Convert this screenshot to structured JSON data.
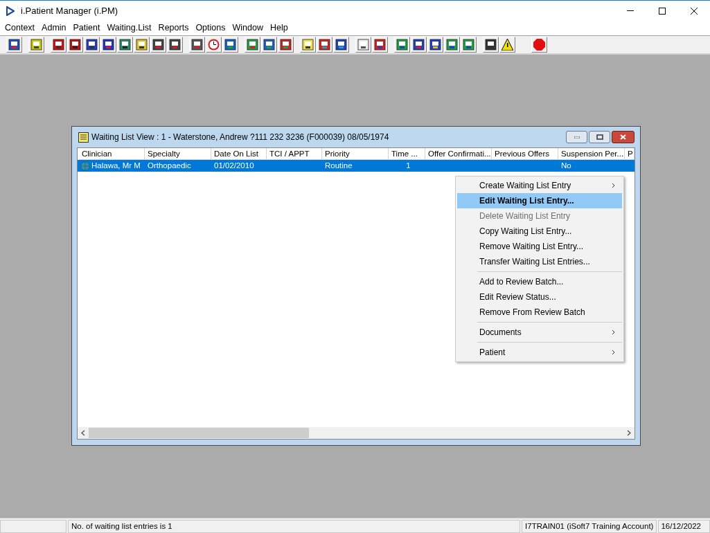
{
  "window": {
    "title": "i.Patient Manager (i.PM)"
  },
  "menu": [
    "Context",
    "Admin",
    "Patient",
    "Waiting.List",
    "Reports",
    "Options",
    "Window",
    "Help"
  ],
  "child_window": {
    "title": "Waiting List View :  1 - Waterstone, Andrew ?111 232 3236 (F000039) 08/05/1974",
    "table": {
      "columns": [
        "Clinician",
        "Specialty",
        "Date On List",
        "TCI / APPT",
        "Priority",
        "Time ...",
        "Offer Confirmati...",
        "Previous Offers",
        "Suspension Per...",
        "P"
      ],
      "rows": [
        {
          "selected": true,
          "cells": [
            "Halawa, Mr M",
            "Orthopaedic",
            "01/02/2010",
            "",
            "Routine",
            "1",
            "",
            "",
            "No",
            ""
          ]
        }
      ]
    }
  },
  "context_menu": [
    {
      "kind": "item",
      "label": "Create Waiting List Entry",
      "submenu": true,
      "disabled": false,
      "selected": false
    },
    {
      "kind": "item",
      "label": "Edit Waiting List Entry...",
      "submenu": false,
      "disabled": false,
      "selected": true
    },
    {
      "kind": "item",
      "label": "Delete Waiting List Entry",
      "submenu": false,
      "disabled": true,
      "selected": false
    },
    {
      "kind": "item",
      "label": "Copy Waiting List Entry...",
      "submenu": false,
      "disabled": false,
      "selected": false
    },
    {
      "kind": "item",
      "label": "Remove Waiting List Entry...",
      "submenu": false,
      "disabled": false,
      "selected": false
    },
    {
      "kind": "item",
      "label": "Transfer Waiting List Entries...",
      "submenu": false,
      "disabled": false,
      "selected": false
    },
    {
      "kind": "separator"
    },
    {
      "kind": "item",
      "label": "Add to Review Batch...",
      "submenu": false,
      "disabled": false,
      "selected": false
    },
    {
      "kind": "item",
      "label": "Edit Review Status...",
      "submenu": false,
      "disabled": false,
      "selected": false
    },
    {
      "kind": "item",
      "label": "Remove From Review Batch",
      "submenu": false,
      "disabled": false,
      "selected": false
    },
    {
      "kind": "separator"
    },
    {
      "kind": "item",
      "label": "Documents",
      "submenu": true,
      "disabled": false,
      "selected": false
    },
    {
      "kind": "separator"
    },
    {
      "kind": "item",
      "label": "Patient",
      "submenu": true,
      "disabled": false,
      "selected": false
    }
  ],
  "status_bar": {
    "message": "No. of waiting list entries is 1",
    "account": "I7TRAIN01 (iSoft7 Training Account)",
    "date": "16/12/2022"
  }
}
